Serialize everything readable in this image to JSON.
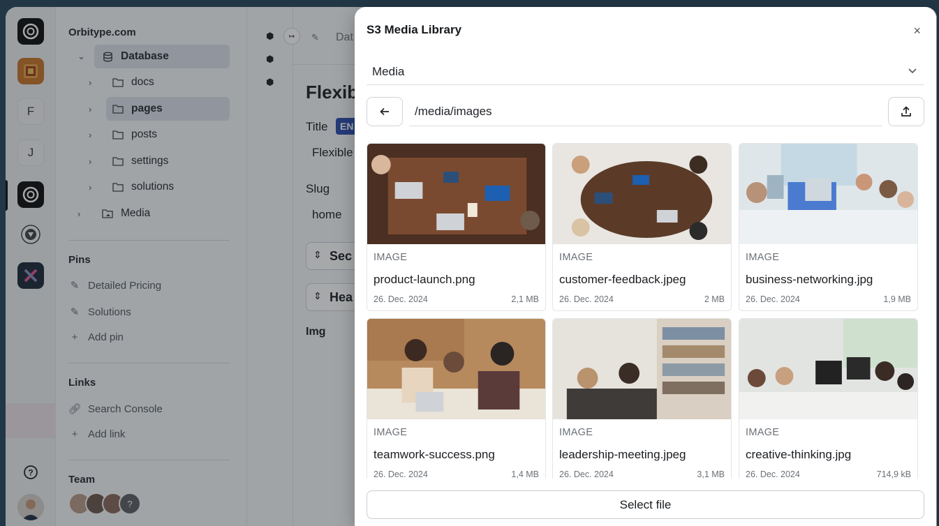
{
  "rail": {
    "letters": [
      "F",
      "J"
    ]
  },
  "sidebar": {
    "site": "Orbitype.com",
    "tree": [
      {
        "label": "Database",
        "icon": "database-icon"
      },
      {
        "label": "docs",
        "icon": "folder-icon"
      },
      {
        "label": "pages",
        "icon": "folder-icon"
      },
      {
        "label": "posts",
        "icon": "folder-icon"
      },
      {
        "label": "settings",
        "icon": "folder-icon"
      },
      {
        "label": "solutions",
        "icon": "folder-icon"
      },
      {
        "label": "Media",
        "icon": "media-folder-icon"
      }
    ],
    "pins_title": "Pins",
    "pins": [
      "Detailed Pricing",
      "Solutions"
    ],
    "add_pin": "Add pin",
    "links_title": "Links",
    "links": [
      "Search Console"
    ],
    "add_link": "Add link",
    "team_title": "Team",
    "team_more": "?"
  },
  "editor": {
    "breadcrumb": "Dat",
    "heading": "Flexib",
    "title_label": "Title",
    "lang_badge": "EN",
    "title_value": "Flexible",
    "slug_label": "Slug",
    "slug_value": "home",
    "section1": "Sec",
    "section2": "Hea",
    "img_label": "Img"
  },
  "modal": {
    "title": "S3 Media Library",
    "source": "Media",
    "path": "/media/images",
    "select_label": "Select file",
    "files": [
      {
        "type": "IMAGE",
        "name": "product-launch.png",
        "date": "26. Dec. 2024",
        "size": "2,1 MB"
      },
      {
        "type": "IMAGE",
        "name": "customer-feedback.jpeg",
        "date": "26. Dec. 2024",
        "size": "2 MB"
      },
      {
        "type": "IMAGE",
        "name": "business-networking.jpg",
        "date": "26. Dec. 2024",
        "size": "1,9 MB"
      },
      {
        "type": "IMAGE",
        "name": "teamwork-success.png",
        "date": "26. Dec. 2024",
        "size": "1,4 MB"
      },
      {
        "type": "IMAGE",
        "name": "leadership-meeting.jpeg",
        "date": "26. Dec. 2024",
        "size": "3,1 MB"
      },
      {
        "type": "IMAGE",
        "name": "creative-thinking.jpg",
        "date": "26. Dec. 2024",
        "size": "714,9 kB"
      }
    ]
  },
  "colors": {
    "brand_dark": "#111111",
    "selection": "#dde3ec",
    "badge": "#2f4fb0"
  }
}
